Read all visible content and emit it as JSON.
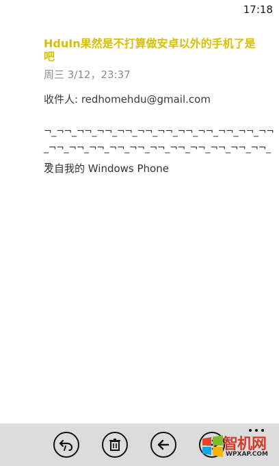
{
  "status_bar": {
    "time": "17:18"
  },
  "email": {
    "subject": "HduIn果然是不打算做安卓以外的手机了是吧",
    "date": "周三 3/12，23:37",
    "recipient_line": "收件人: redhomehdu@gmail.com",
    "body_text": "¬_¬¬_¬¬_¬¬_¬¬_¬¬_¬¬_¬¬_¬¬_¬¬_¬¬_¬¬_¬¬_¬¬_¬¬_¬¬_¬¬_¬¬_¬¬_¬¬_¬¬_¬¬_¬¬_¬",
    "signature": "发自我的 Windows Phone"
  },
  "app_bar": {
    "buttons": [
      {
        "icon": "reply-icon"
      },
      {
        "icon": "delete-icon"
      },
      {
        "icon": "back-icon"
      },
      {
        "icon": "forward-icon"
      }
    ],
    "more_icon": "more-dots-icon"
  },
  "watermark": {
    "title": "智机网",
    "subtitle": "WPXAP.COM"
  },
  "colors": {
    "accent": "#d8c000",
    "date_gray": "#8c8c8c",
    "app_bar_bg": "#dcdcdc"
  }
}
